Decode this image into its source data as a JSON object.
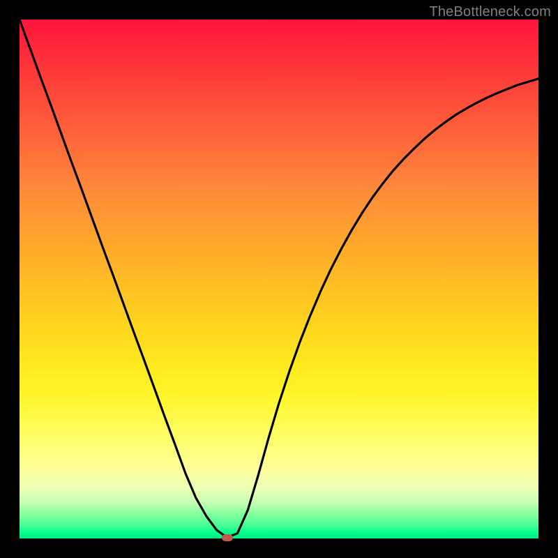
{
  "watermark": "TheBottleneck.com",
  "chart_data": {
    "type": "line",
    "title": "",
    "xlabel": "",
    "ylabel": "",
    "xlim": [
      0,
      1
    ],
    "ylim": [
      0,
      1
    ],
    "x": [
      0.0,
      0.02,
      0.04,
      0.06,
      0.08,
      0.1,
      0.12,
      0.14,
      0.16,
      0.18,
      0.2,
      0.22,
      0.24,
      0.26,
      0.28,
      0.3,
      0.32,
      0.34,
      0.36,
      0.38,
      0.4,
      0.42,
      0.44,
      0.46,
      0.48,
      0.5,
      0.52,
      0.54,
      0.56,
      0.58,
      0.6,
      0.62,
      0.64,
      0.66,
      0.68,
      0.7,
      0.72,
      0.74,
      0.76,
      0.78,
      0.8,
      0.82,
      0.84,
      0.86,
      0.88,
      0.9,
      0.92,
      0.94,
      0.96,
      0.98,
      1.0
    ],
    "values": [
      1.0,
      0.945,
      0.89,
      0.836,
      0.781,
      0.726,
      0.672,
      0.617,
      0.562,
      0.508,
      0.453,
      0.398,
      0.344,
      0.289,
      0.234,
      0.18,
      0.125,
      0.078,
      0.043,
      0.016,
      0.002,
      0.01,
      0.055,
      0.122,
      0.194,
      0.261,
      0.322,
      0.378,
      0.429,
      0.476,
      0.519,
      0.558,
      0.594,
      0.627,
      0.657,
      0.684,
      0.709,
      0.731,
      0.751,
      0.77,
      0.787,
      0.802,
      0.816,
      0.828,
      0.839,
      0.849,
      0.858,
      0.866,
      0.874,
      0.88,
      0.886
    ],
    "min_marker": {
      "x": 0.4,
      "y": 0.0,
      "color": "#c05a4a"
    },
    "background_gradient": [
      "#ff143c",
      "#ffaa2a",
      "#ffe81e",
      "#ffff96",
      "#00ff8c"
    ]
  }
}
